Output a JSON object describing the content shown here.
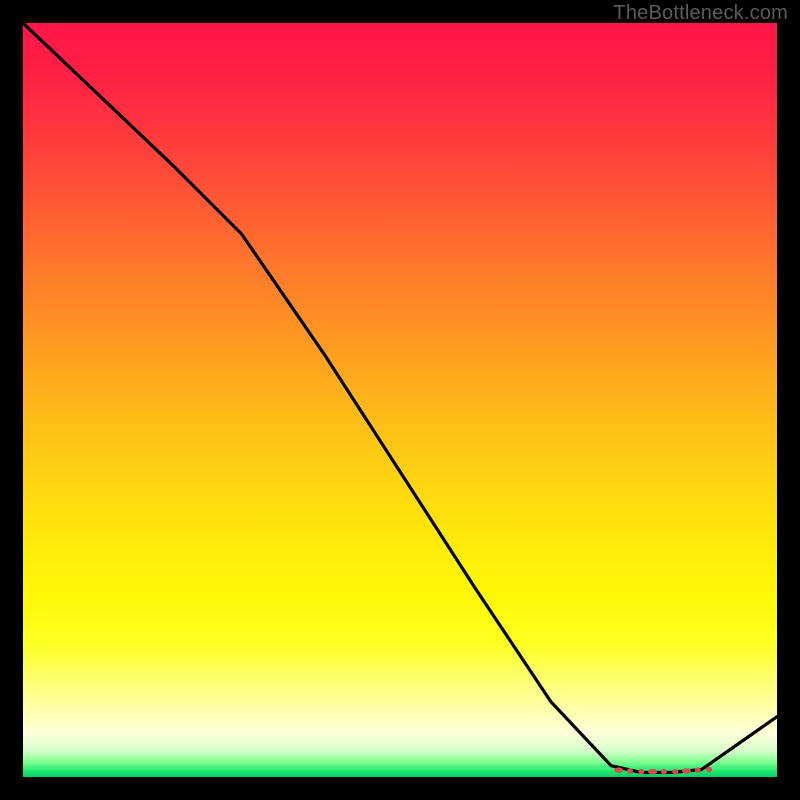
{
  "watermark": "TheBottleneck.com",
  "chart_data": {
    "type": "line",
    "title": "",
    "xlabel": "",
    "ylabel": "",
    "xlim": [
      0,
      100
    ],
    "ylim": [
      0,
      100
    ],
    "grid": false,
    "series": [
      {
        "name": "curve",
        "color": "#000000",
        "x": [
          0,
          10,
          20,
          29,
          40,
          50,
          60,
          70,
          78,
          82,
          86,
          90,
          100
        ],
        "y": [
          100,
          90.5,
          81,
          72,
          56,
          40.5,
          25,
          10,
          1.5,
          0.6,
          0.6,
          1.0,
          8
        ]
      }
    ],
    "markers": {
      "name": "flat-segment-markers",
      "color": "#d94a4a",
      "x": [
        79,
        80.5,
        82,
        83.5,
        85,
        86.5,
        88,
        89.5,
        91
      ],
      "y": [
        0.9,
        0.8,
        0.7,
        0.7,
        0.7,
        0.7,
        0.8,
        0.9,
        1.0
      ]
    }
  }
}
